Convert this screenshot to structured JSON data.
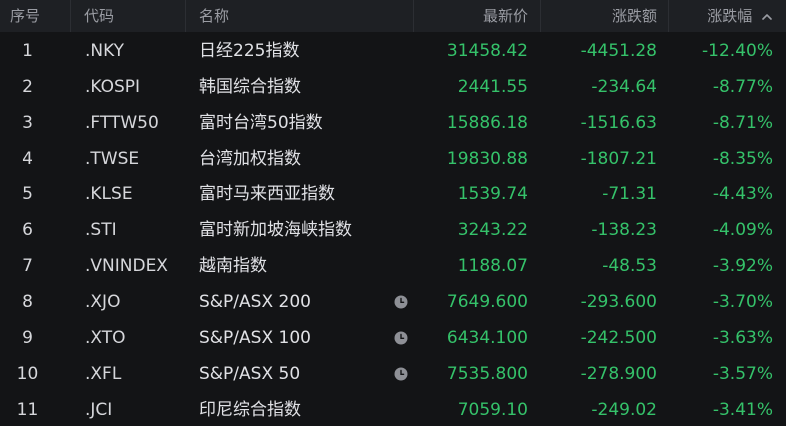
{
  "header": {
    "index": "序号",
    "code": "代码",
    "name": "名称",
    "price": "最新价",
    "change": "涨跌额",
    "pct": "涨跌幅"
  },
  "colors": {
    "down": "#35c26a",
    "background": "#131416",
    "header_bg": "#1e2024"
  },
  "rows": [
    {
      "index": "1",
      "code": ".NKY",
      "name": "日经225指数",
      "price": "31458.42",
      "change": "-4451.28",
      "pct": "-12.40%",
      "clock": false
    },
    {
      "index": "2",
      "code": ".KOSPI",
      "name": "韩国综合指数",
      "price": "2441.55",
      "change": "-234.64",
      "pct": "-8.77%",
      "clock": false
    },
    {
      "index": "3",
      "code": ".FTTW50",
      "name": "富时台湾50指数",
      "price": "15886.18",
      "change": "-1516.63",
      "pct": "-8.71%",
      "clock": false
    },
    {
      "index": "4",
      "code": ".TWSE",
      "name": "台湾加权指数",
      "price": "19830.88",
      "change": "-1807.21",
      "pct": "-8.35%",
      "clock": false
    },
    {
      "index": "5",
      "code": ".KLSE",
      "name": "富时马来西亚指数",
      "price": "1539.74",
      "change": "-71.31",
      "pct": "-4.43%",
      "clock": false
    },
    {
      "index": "6",
      "code": ".STI",
      "name": "富时新加坡海峡指数",
      "price": "3243.22",
      "change": "-138.23",
      "pct": "-4.09%",
      "clock": false
    },
    {
      "index": "7",
      "code": ".VNINDEX",
      "name": "越南指数",
      "price": "1188.07",
      "change": "-48.53",
      "pct": "-3.92%",
      "clock": false
    },
    {
      "index": "8",
      "code": ".XJO",
      "name": "S&P/ASX 200",
      "price": "7649.600",
      "change": "-293.600",
      "pct": "-3.70%",
      "clock": true
    },
    {
      "index": "9",
      "code": ".XTO",
      "name": "S&P/ASX 100",
      "price": "6434.100",
      "change": "-242.500",
      "pct": "-3.63%",
      "clock": true
    },
    {
      "index": "10",
      "code": ".XFL",
      "name": "S&P/ASX 50",
      "price": "7535.800",
      "change": "-278.900",
      "pct": "-3.57%",
      "clock": true
    },
    {
      "index": "11",
      "code": ".JCI",
      "name": "印尼综合指数",
      "price": "7059.10",
      "change": "-249.02",
      "pct": "-3.41%",
      "clock": false
    }
  ]
}
